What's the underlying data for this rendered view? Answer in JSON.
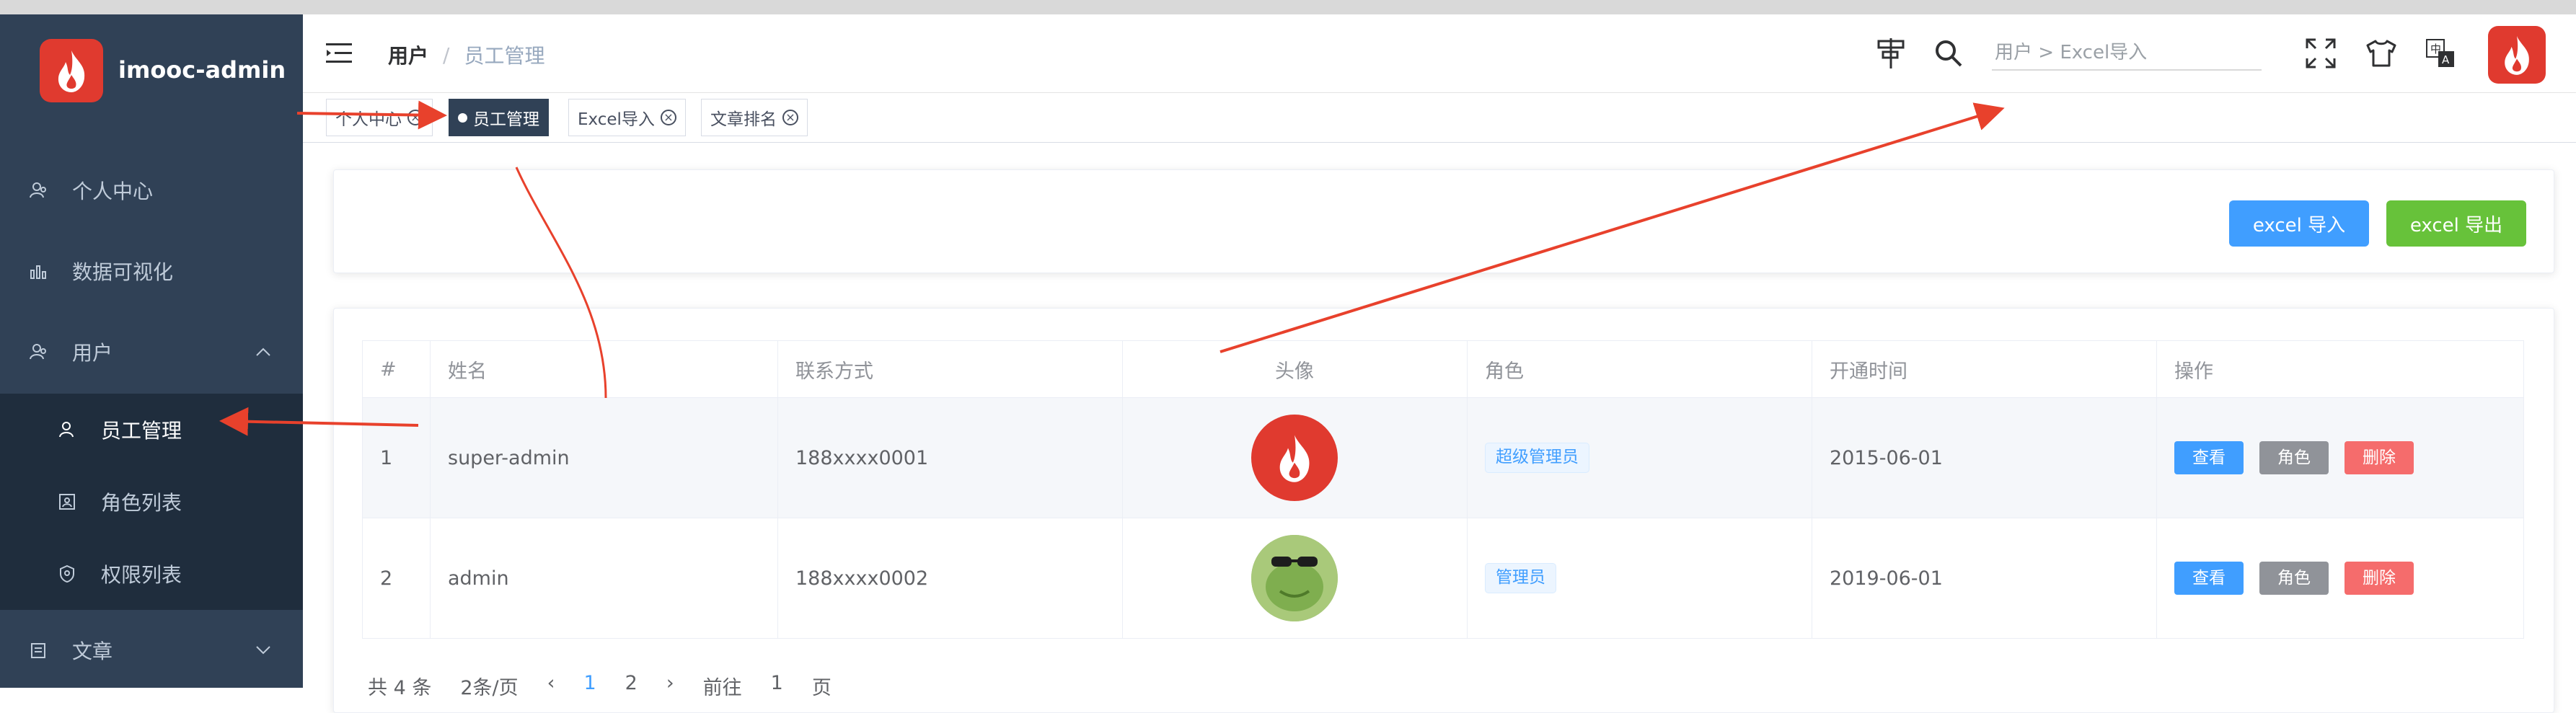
{
  "app": {
    "title": "imooc-admin",
    "brand_color": "#e03a2f",
    "sidebar_bg": "#304156"
  },
  "sidebar": {
    "items": [
      {
        "label": "个人中心",
        "icon": "user-profile-icon"
      },
      {
        "label": "数据可视化",
        "icon": "bar-chart-icon"
      },
      {
        "label": "用户",
        "icon": "users-icon",
        "expanded": true,
        "children": [
          {
            "label": "员工管理",
            "icon": "employee-icon",
            "active": true
          },
          {
            "label": "角色列表",
            "icon": "role-icon"
          },
          {
            "label": "权限列表",
            "icon": "permission-icon"
          }
        ]
      },
      {
        "label": "文章",
        "icon": "article-icon",
        "expanded": false
      }
    ]
  },
  "navbar": {
    "breadcrumb": {
      "home": "用户",
      "sep": "/",
      "current": "员工管理"
    },
    "search": {
      "placeholder": "用户 > Excel导入"
    },
    "icons": [
      "guide-icon",
      "search-icon",
      "fullscreen-icon",
      "theme-icon",
      "language-icon"
    ]
  },
  "tags": [
    {
      "label": "个人中心"
    },
    {
      "label": "员工管理",
      "active": true
    },
    {
      "label": "Excel导入"
    },
    {
      "label": "文章排名"
    }
  ],
  "toolbar": {
    "import_label": "excel 导入",
    "export_label": "excel 导出"
  },
  "table": {
    "headers": [
      "#",
      "姓名",
      "联系方式",
      "头像",
      "角色",
      "开通时间",
      "操作"
    ],
    "rows": [
      {
        "index": "1",
        "name": "super-admin",
        "phone": "188xxxx0001",
        "role": "超级管理员",
        "date": "2015-06-01",
        "avatar": "flame-avatar"
      },
      {
        "index": "2",
        "name": "admin",
        "phone": "188xxxx0002",
        "role": "管理员",
        "date": "2019-06-01",
        "avatar": "frog-avatar"
      }
    ],
    "actions": {
      "view": "查看",
      "role": "角色",
      "delete": "删除"
    }
  },
  "pagination": {
    "total": "共 4 条",
    "page_size": "2条/页",
    "prev": "‹",
    "pages": [
      "1",
      "2"
    ],
    "next": "›",
    "goto": "前往",
    "goto_value": "1",
    "page_unit": "页"
  },
  "annotation_color": "#e8412c"
}
